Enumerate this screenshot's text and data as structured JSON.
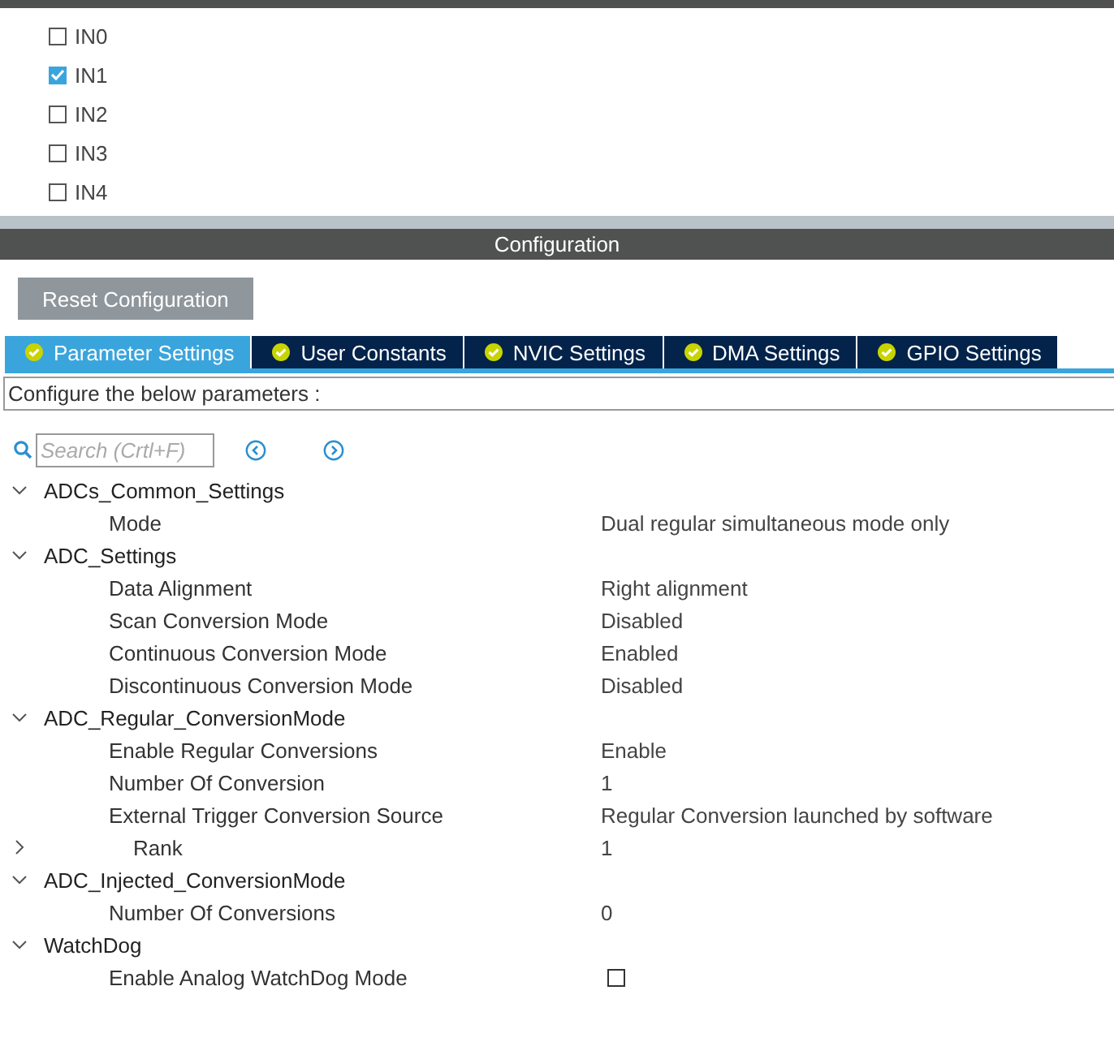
{
  "channels": [
    {
      "label": "IN0",
      "checked": false
    },
    {
      "label": "IN1",
      "checked": true
    },
    {
      "label": "IN2",
      "checked": false
    },
    {
      "label": "IN3",
      "checked": false
    },
    {
      "label": "IN4",
      "checked": false
    }
  ],
  "panel": {
    "title": "Configuration"
  },
  "reset_button": "Reset Configuration",
  "tabs": [
    {
      "label": "Parameter Settings",
      "selected": true
    },
    {
      "label": "User Constants",
      "selected": false
    },
    {
      "label": "NVIC Settings",
      "selected": false
    },
    {
      "label": "DMA Settings",
      "selected": false
    },
    {
      "label": "GPIO Settings",
      "selected": false
    }
  ],
  "description": "Configure the below parameters :",
  "search": {
    "placeholder": "Search (Crtl+F)"
  },
  "tree": [
    {
      "label": "ADCs_Common_Settings",
      "expanded": true,
      "children": [
        {
          "label": "Mode",
          "value": "Dual regular simultaneous mode only"
        }
      ]
    },
    {
      "label": "ADC_Settings",
      "expanded": true,
      "children": [
        {
          "label": "Data Alignment",
          "value": "Right alignment"
        },
        {
          "label": "Scan Conversion Mode",
          "value": "Disabled"
        },
        {
          "label": "Continuous Conversion Mode",
          "value": "Enabled"
        },
        {
          "label": "Discontinuous Conversion Mode",
          "value": "Disabled"
        }
      ]
    },
    {
      "label": "ADC_Regular_ConversionMode",
      "expanded": true,
      "children": [
        {
          "label": "Enable Regular Conversions",
          "value": "Enable"
        },
        {
          "label": "Number Of Conversion",
          "value": "1"
        },
        {
          "label": "External Trigger Conversion Source",
          "value": "Regular Conversion launched by software"
        },
        {
          "label": "Rank",
          "value": "1",
          "expanded": false
        }
      ]
    },
    {
      "label": "ADC_Injected_ConversionMode",
      "expanded": true,
      "children": [
        {
          "label": "Number Of Conversions",
          "value": "0"
        }
      ]
    },
    {
      "label": "WatchDog",
      "expanded": true,
      "children": [
        {
          "label": "Enable Analog WatchDog Mode",
          "kind": "checkbox",
          "checked": false
        }
      ]
    }
  ]
}
